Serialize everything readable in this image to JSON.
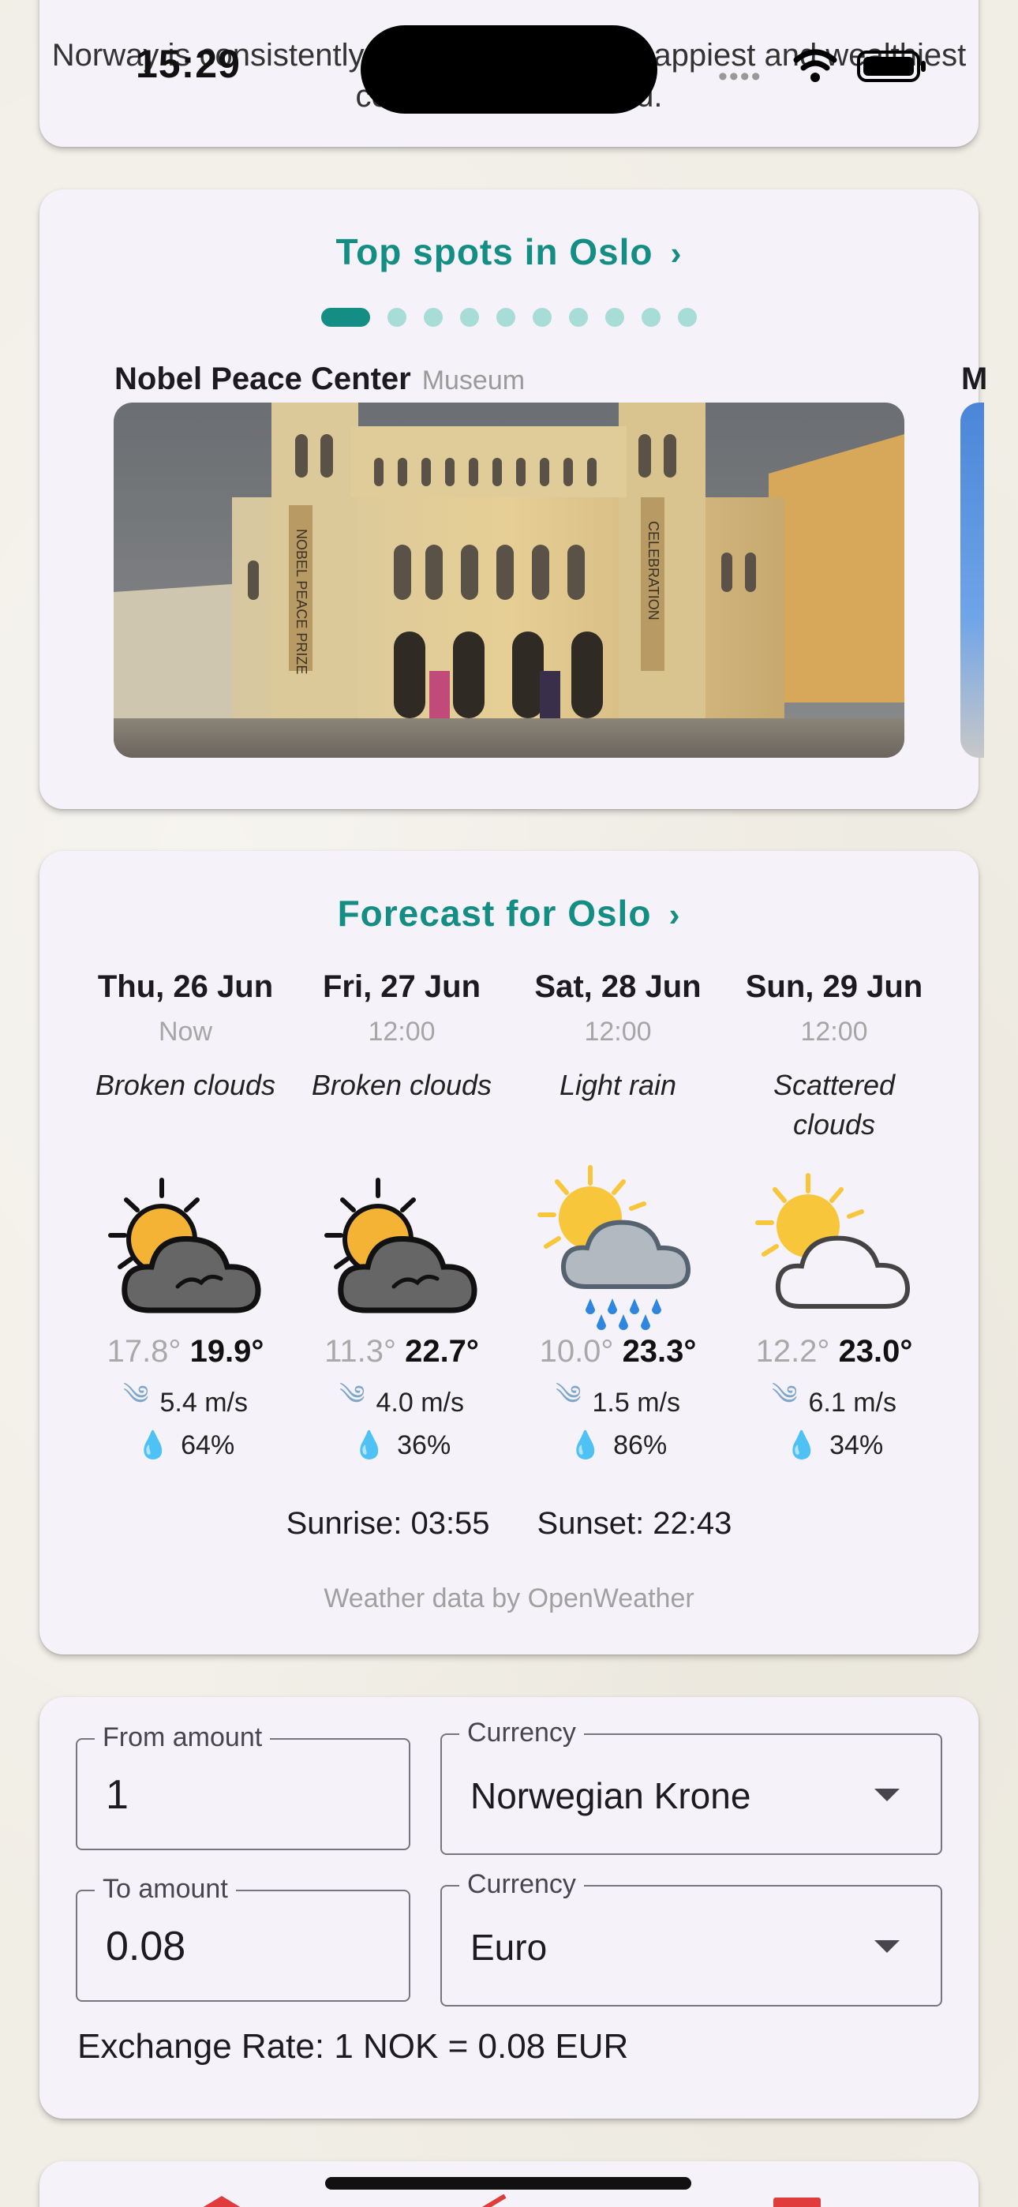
{
  "status_bar": {
    "time": "15:29"
  },
  "intro": {
    "text": "Norway is consistently ranked among the happiest and wealthiest countries in the world."
  },
  "spots": {
    "title": "Top spots in Oslo",
    "dot_count": 10,
    "active_index": 0,
    "items": [
      {
        "name": "Nobel Peace Center",
        "category": "Museum",
        "banner_left": "NOBEL PEACE PRIZE",
        "banner_right": "CELEBRATION"
      },
      {
        "name": "M"
      }
    ]
  },
  "forecast": {
    "title": "Forecast for Oslo",
    "days": [
      {
        "date": "Thu, 26 Jun",
        "time": "Now",
        "desc": "Broken clouds",
        "icon": "sun-dark-cloud-icon",
        "low": "17.8°",
        "high": "19.9°",
        "wind": "5.4 m/s",
        "humidity": "64%"
      },
      {
        "date": "Fri, 27 Jun",
        "time": "12:00",
        "desc": "Broken clouds",
        "icon": "sun-dark-cloud-icon",
        "low": "11.3°",
        "high": "22.7°",
        "wind": "4.0 m/s",
        "humidity": "36%"
      },
      {
        "date": "Sat, 28 Jun",
        "time": "12:00",
        "desc": "Light rain",
        "icon": "sun-rain-cloud-icon",
        "low": "10.0°",
        "high": "23.3°",
        "wind": "1.5 m/s",
        "humidity": "86%"
      },
      {
        "date": "Sun, 29 Jun",
        "time": "12:00",
        "desc": "Scattered clouds",
        "icon": "sun-white-cloud-icon",
        "low": "12.2°",
        "high": "23.0°",
        "wind": "6.1 m/s",
        "humidity": "34%"
      }
    ],
    "sunrise": "Sunrise: 03:55",
    "sunset": "Sunset: 22:43",
    "credit": "Weather data by OpenWeather"
  },
  "currency": {
    "from_label": "From amount",
    "from_value": "1",
    "from_currency_label": "Currency",
    "from_currency": "Norwegian Krone",
    "to_label": "To amount",
    "to_value": "0.08",
    "to_currency_label": "Currency",
    "to_currency": "Euro",
    "rate_text": "Exchange Rate: 1 NOK = 0.08 EUR"
  },
  "colors": {
    "accent": "#148e84",
    "card": "#f6f2f9",
    "background": "#f1eee6"
  }
}
